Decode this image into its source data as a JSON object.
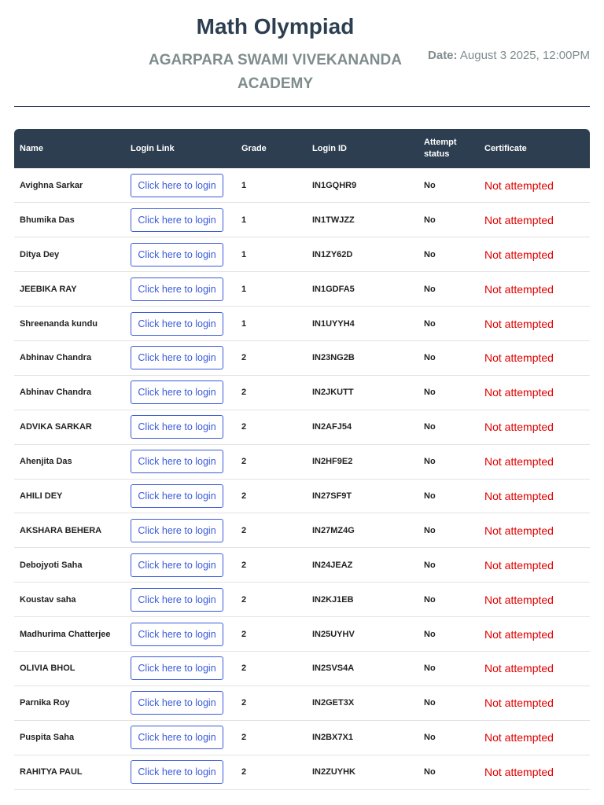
{
  "header": {
    "title": "Math Olympiad",
    "school": "AGARPARA SWAMI VIVEKANANDA ACADEMY",
    "date_label": "Date:",
    "date_value": "August 3 2025, 12:00PM"
  },
  "table": {
    "columns": [
      "Name",
      "Login Link",
      "Grade",
      "Login ID",
      "Attempt status",
      "Certificate"
    ],
    "rows": [
      {
        "name": "Avighna Sarkar",
        "link": "Click here to login",
        "grade": "1",
        "login_id": "IN1GQHR9",
        "status": "No",
        "certificate": "Not attempted"
      },
      {
        "name": "Bhumika Das",
        "link": "Click here to login",
        "grade": "1",
        "login_id": "IN1TWJZZ",
        "status": "No",
        "certificate": "Not attempted"
      },
      {
        "name": "Ditya Dey",
        "link": "Click here to login",
        "grade": "1",
        "login_id": "IN1ZY62D",
        "status": "No",
        "certificate": "Not attempted"
      },
      {
        "name": "JEEBIKA RAY",
        "link": "Click here to login",
        "grade": "1",
        "login_id": "IN1GDFA5",
        "status": "No",
        "certificate": "Not attempted"
      },
      {
        "name": "Shreenanda kundu",
        "link": "Click here to login",
        "grade": "1",
        "login_id": "IN1UYYH4",
        "status": "No",
        "certificate": "Not attempted"
      },
      {
        "name": "Abhinav Chandra",
        "link": "Click here to login",
        "grade": "2",
        "login_id": "IN23NG2B",
        "status": "No",
        "certificate": "Not attempted"
      },
      {
        "name": "Abhinav Chandra",
        "link": "Click here to login",
        "grade": "2",
        "login_id": "IN2JKUTT",
        "status": "No",
        "certificate": "Not attempted"
      },
      {
        "name": "ADVIKA SARKAR",
        "link": "Click here to login",
        "grade": "2",
        "login_id": "IN2AFJ54",
        "status": "No",
        "certificate": "Not attempted"
      },
      {
        "name": "Ahenjita Das",
        "link": "Click here to login",
        "grade": "2",
        "login_id": "IN2HF9E2",
        "status": "No",
        "certificate": "Not attempted"
      },
      {
        "name": "AHILI DEY",
        "link": "Click here to login",
        "grade": "2",
        "login_id": "IN27SF9T",
        "status": "No",
        "certificate": "Not attempted"
      },
      {
        "name": "AKSHARA BEHERA",
        "link": "Click here to login",
        "grade": "2",
        "login_id": "IN27MZ4G",
        "status": "No",
        "certificate": "Not attempted"
      },
      {
        "name": "Debojyoti Saha",
        "link": "Click here to login",
        "grade": "2",
        "login_id": "IN24JEAZ",
        "status": "No",
        "certificate": "Not attempted"
      },
      {
        "name": "Koustav saha",
        "link": "Click here to login",
        "grade": "2",
        "login_id": "IN2KJ1EB",
        "status": "No",
        "certificate": "Not attempted"
      },
      {
        "name": "Madhurima Chatterjee",
        "link": "Click here to login",
        "grade": "2",
        "login_id": "IN25UYHV",
        "status": "No",
        "certificate": "Not attempted"
      },
      {
        "name": "OLIVIA BHOL",
        "link": "Click here to login",
        "grade": "2",
        "login_id": "IN2SVS4A",
        "status": "No",
        "certificate": "Not attempted"
      },
      {
        "name": "Parnika Roy",
        "link": "Click here to login",
        "grade": "2",
        "login_id": "IN2GET3X",
        "status": "No",
        "certificate": "Not attempted"
      },
      {
        "name": "Puspita Saha",
        "link": "Click here to login",
        "grade": "2",
        "login_id": "IN2BX7X1",
        "status": "No",
        "certificate": "Not attempted"
      },
      {
        "name": "RAHITYA PAUL",
        "link": "Click here to login",
        "grade": "2",
        "login_id": "IN2ZUYHK",
        "status": "No",
        "certificate": "Not attempted"
      }
    ]
  },
  "colors": {
    "header_bg": "#2c3e50",
    "link": "#3b5bdb",
    "certificate": "#e00000",
    "muted": "#7f8c8d"
  }
}
